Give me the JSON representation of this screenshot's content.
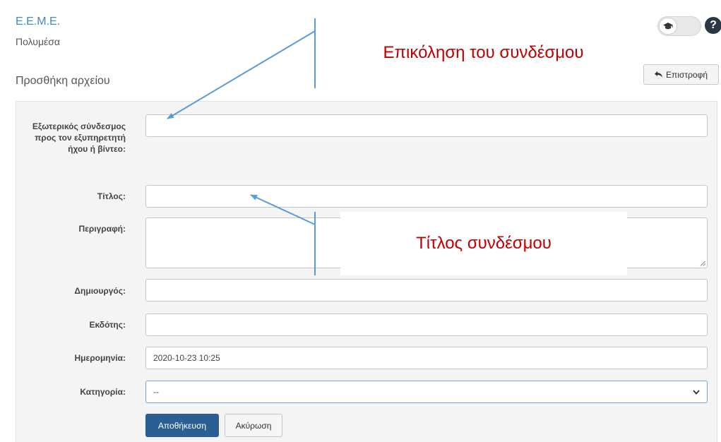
{
  "header": {
    "course_name": "Ε.Ε.Μ.Ε.",
    "module_name": "Πολυμέσα",
    "page_title": "Προσθήκη αρχείου",
    "help_symbol": "?",
    "back_label": "Επιστροφή"
  },
  "form": {
    "fields": [
      {
        "label": "Εξωτερικός σύνδεσμος προς τον εξυπηρετητή ήχου ή βίντεο:",
        "value": ""
      },
      {
        "label": "Τίτλος:",
        "value": ""
      },
      {
        "label": "Περιγραφή:",
        "value": ""
      },
      {
        "label": "Δημιουργός:",
        "value": ""
      },
      {
        "label": "Εκδότης:",
        "value": ""
      },
      {
        "label": "Ημερομηνία:",
        "value": "2020-10-23 10:25"
      },
      {
        "label": "Κατηγορία:",
        "value": "--"
      }
    ],
    "save_label": "Αποθήκευση",
    "cancel_label": "Ακύρωση"
  },
  "annotations": {
    "link_callout": "Επικόληση του συνδέσμου",
    "title_callout": "Τίτλος συνδέσμου",
    "arrow_color": "#5b9bd5",
    "text_color": "#c00000"
  },
  "colors": {
    "link": "#3d88c7",
    "primary_button": "#2a5f93",
    "panel_background": "#f4f4f4"
  },
  "icons": {
    "toggle": "graduation-cap-icon",
    "help": "question-circle-icon",
    "back": "reply-arrow-icon",
    "select": "chevron-down-icon",
    "textarea": "resize-grip-icon"
  }
}
